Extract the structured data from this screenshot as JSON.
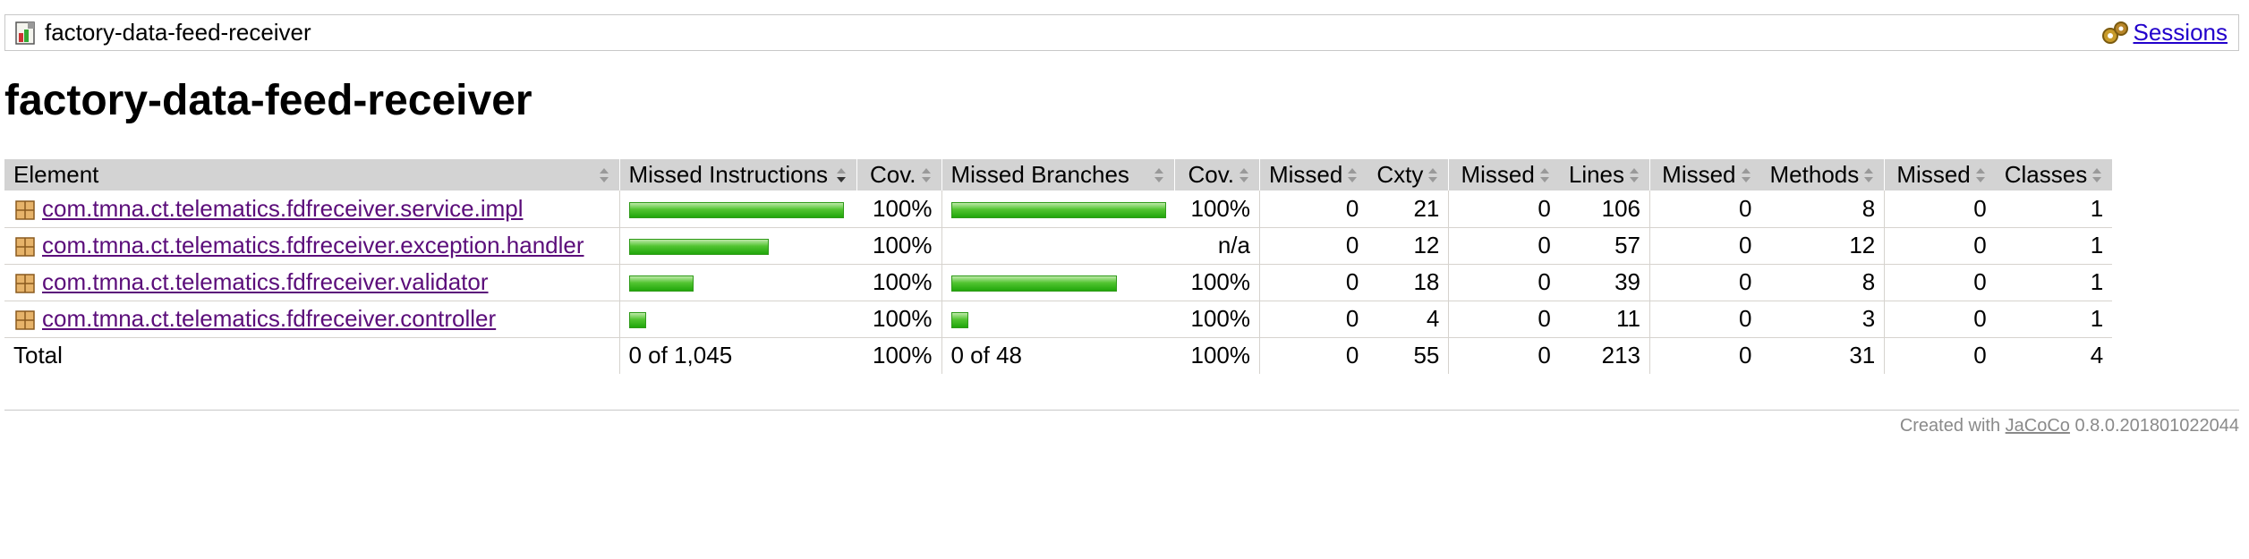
{
  "breadcrumb": {
    "report_name": "factory-data-feed-receiver",
    "sessions_label": "Sessions"
  },
  "page_title": "factory-data-feed-receiver",
  "table": {
    "headers": {
      "element": "Element",
      "missed_instructions": "Missed Instructions",
      "cov_instructions": "Cov.",
      "missed_branches": "Missed Branches",
      "cov_branches": "Cov.",
      "missed_cxty": "Missed",
      "cxty": "Cxty",
      "missed_lines": "Missed",
      "lines": "Lines",
      "missed_methods": "Missed",
      "methods": "Methods",
      "missed_classes": "Missed",
      "classes": "Classes"
    },
    "rows": [
      {
        "name": "com.tmna.ct.telematics.fdfreceiver.service.impl",
        "instr_bar_fraction": 1.0,
        "instr_cov": "100%",
        "branch_bar_fraction": 1.0,
        "branch_cov": "100%",
        "missed_cxty": "0",
        "cxty": "21",
        "missed_lines": "0",
        "lines": "106",
        "missed_methods": "0",
        "methods": "8",
        "missed_classes": "0",
        "classes": "1"
      },
      {
        "name": "com.tmna.ct.telematics.fdfreceiver.exception.handler",
        "instr_bar_fraction": 0.65,
        "instr_cov": "100%",
        "branch_bar_fraction": 0,
        "branch_cov": "n/a",
        "missed_cxty": "0",
        "cxty": "12",
        "missed_lines": "0",
        "lines": "57",
        "missed_methods": "0",
        "methods": "12",
        "missed_classes": "0",
        "classes": "1"
      },
      {
        "name": "com.tmna.ct.telematics.fdfreceiver.validator",
        "instr_bar_fraction": 0.3,
        "instr_cov": "100%",
        "branch_bar_fraction": 0.77,
        "branch_cov": "100%",
        "missed_cxty": "0",
        "cxty": "18",
        "missed_lines": "0",
        "lines": "39",
        "missed_methods": "0",
        "methods": "8",
        "missed_classes": "0",
        "classes": "1"
      },
      {
        "name": "com.tmna.ct.telematics.fdfreceiver.controller",
        "instr_bar_fraction": 0.08,
        "instr_cov": "100%",
        "branch_bar_fraction": 0.08,
        "branch_cov": "100%",
        "missed_cxty": "0",
        "cxty": "4",
        "missed_lines": "0",
        "lines": "11",
        "missed_methods": "0",
        "methods": "3",
        "missed_classes": "0",
        "classes": "1"
      }
    ],
    "total": {
      "label": "Total",
      "instructions": "0 of 1,045",
      "instr_cov": "100%",
      "branches": "0 of 48",
      "branch_cov": "100%",
      "missed_cxty": "0",
      "cxty": "55",
      "missed_lines": "0",
      "lines": "213",
      "missed_methods": "0",
      "methods": "31",
      "missed_classes": "0",
      "classes": "4"
    }
  },
  "footer": {
    "prefix": "Created with",
    "tool": "JaCoCo",
    "version": "0.8.0.201801022044"
  },
  "colors": {
    "header_bg": "#d3d3d3",
    "bar_green": "#21a60b",
    "link": "#2200cc",
    "visited_link": "#5b0d7a"
  },
  "icons": {
    "report": "report-icon",
    "session": "session-icon",
    "package": "package-icon",
    "sort": "sort-icon",
    "sort_down": "sort-down-icon"
  }
}
